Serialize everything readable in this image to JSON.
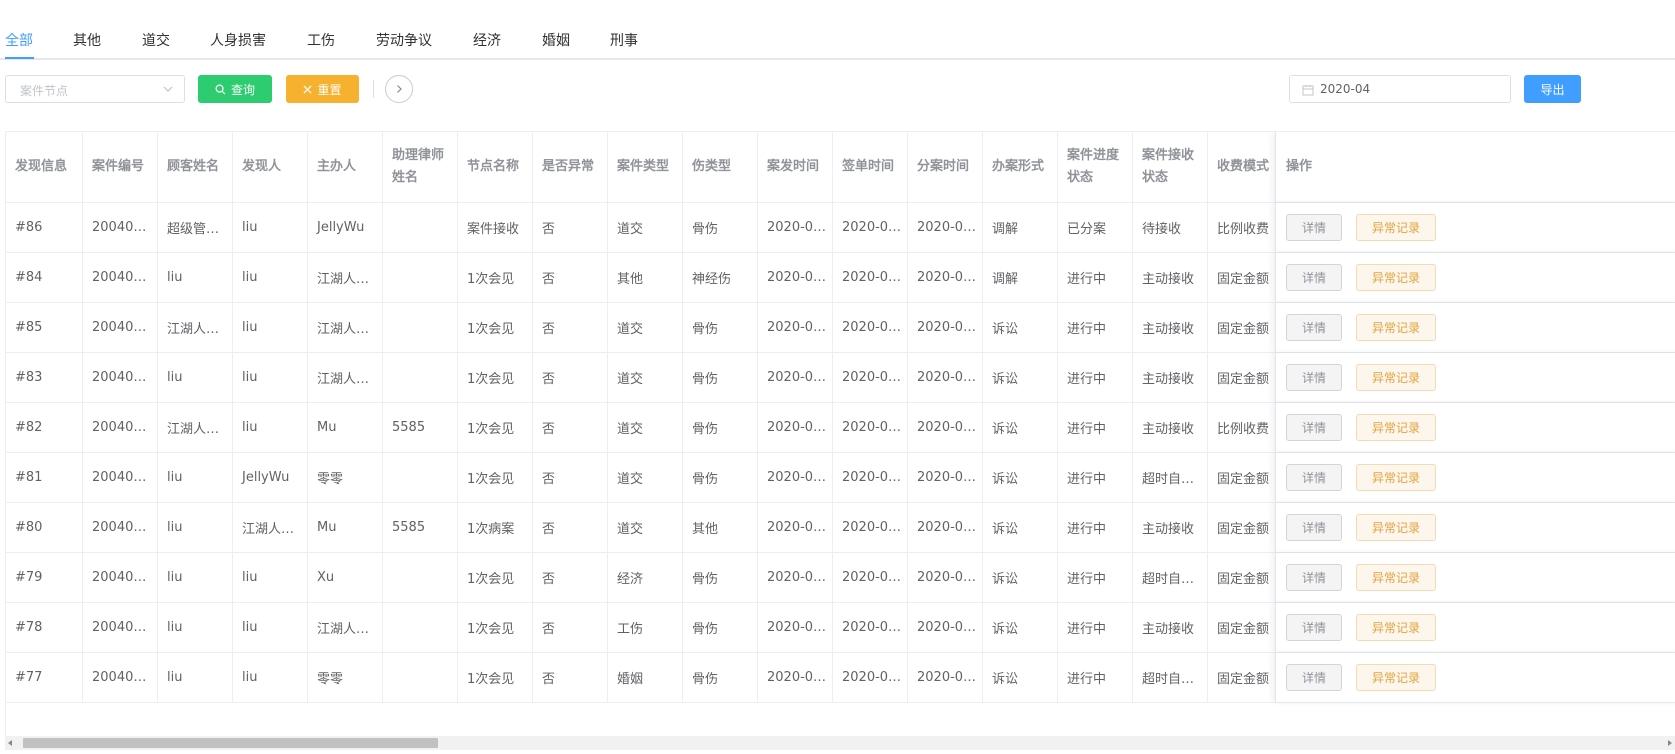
{
  "tabs": [
    {
      "label": "全部",
      "active": true
    },
    {
      "label": "其他"
    },
    {
      "label": "道交"
    },
    {
      "label": "人身损害"
    },
    {
      "label": "工伤"
    },
    {
      "label": "劳动争议"
    },
    {
      "label": "经济"
    },
    {
      "label": "婚姻"
    },
    {
      "label": "刑事"
    }
  ],
  "toolbar": {
    "node_select_placeholder": "案件节点",
    "search_label": "查询",
    "reset_label": "重置",
    "date_value": "2020-04",
    "export_label": "导出"
  },
  "colors": {
    "primary": "#409eff",
    "search": "#2ecc71",
    "reset": "#f6b12f",
    "abnormal_text": "#e6a23c"
  },
  "table": {
    "headers": [
      "发现信息",
      "案件编号",
      "顾客姓名",
      "发现人",
      "主办人",
      "助理律师姓名",
      "节点名称",
      "是否异常",
      "案件类型",
      "伤类型",
      "案发时间",
      "签单时间",
      "分案时间",
      "办案形式",
      "案件进度状态",
      "案件接收状态",
      "收费模式",
      "操作"
    ],
    "detail_label": "详情",
    "abnormal_label": "异常记录",
    "rows": [
      [
        "#86",
        "20040…",
        "超级管…",
        "liu",
        "JellyWu",
        "",
        "案件接收",
        "否",
        "道交",
        "骨伤",
        "2020-0…",
        "2020-0…",
        "2020-0…",
        "调解",
        "已分案",
        "待接收",
        "比例收费"
      ],
      [
        "#84",
        "20040…",
        "liu",
        "liu",
        "江湖人…",
        "",
        "1次会见",
        "否",
        "其他",
        "神经伤",
        "2020-0…",
        "2020-0…",
        "2020-0…",
        "调解",
        "进行中",
        "主动接收",
        "固定金额"
      ],
      [
        "#85",
        "20040…",
        "江湖人…",
        "liu",
        "江湖人…",
        "",
        "1次会见",
        "否",
        "道交",
        "骨伤",
        "2020-0…",
        "2020-0…",
        "2020-0…",
        "诉讼",
        "进行中",
        "主动接收",
        "固定金额"
      ],
      [
        "#83",
        "20040…",
        "liu",
        "liu",
        "江湖人…",
        "",
        "1次会见",
        "否",
        "道交",
        "骨伤",
        "2020-0…",
        "2020-0…",
        "2020-0…",
        "诉讼",
        "进行中",
        "主动接收",
        "固定金额"
      ],
      [
        "#82",
        "20040…",
        "江湖人…",
        "liu",
        "Mu",
        "5585",
        "1次会见",
        "否",
        "道交",
        "骨伤",
        "2020-0…",
        "2020-0…",
        "2020-0…",
        "诉讼",
        "进行中",
        "主动接收",
        "比例收费"
      ],
      [
        "#81",
        "20040…",
        "liu",
        "JellyWu",
        "零零",
        "",
        "1次会见",
        "否",
        "道交",
        "骨伤",
        "2020-0…",
        "2020-0…",
        "2020-0…",
        "诉讼",
        "进行中",
        "超时自…",
        "固定金额"
      ],
      [
        "#80",
        "20040…",
        "liu",
        "江湖人…",
        "Mu",
        "5585",
        "1次病案",
        "否",
        "道交",
        "其他",
        "2020-0…",
        "2020-0…",
        "2020-0…",
        "诉讼",
        "进行中",
        "主动接收",
        "固定金额"
      ],
      [
        "#79",
        "20040…",
        "liu",
        "liu",
        "Xu",
        "",
        "1次会见",
        "否",
        "经济",
        "骨伤",
        "2020-0…",
        "2020-0…",
        "2020-0…",
        "诉讼",
        "进行中",
        "超时自…",
        "固定金额"
      ],
      [
        "#78",
        "20040…",
        "liu",
        "liu",
        "江湖人…",
        "",
        "1次会见",
        "否",
        "工伤",
        "骨伤",
        "2020-0…",
        "2020-0…",
        "2020-0…",
        "诉讼",
        "进行中",
        "主动接收",
        "固定金额"
      ],
      [
        "#77",
        "20040…",
        "liu",
        "liu",
        "零零",
        "",
        "1次会见",
        "否",
        "婚姻",
        "骨伤",
        "2020-0…",
        "2020-0…",
        "2020-0…",
        "诉讼",
        "进行中",
        "超时自…",
        "固定金额"
      ]
    ]
  }
}
